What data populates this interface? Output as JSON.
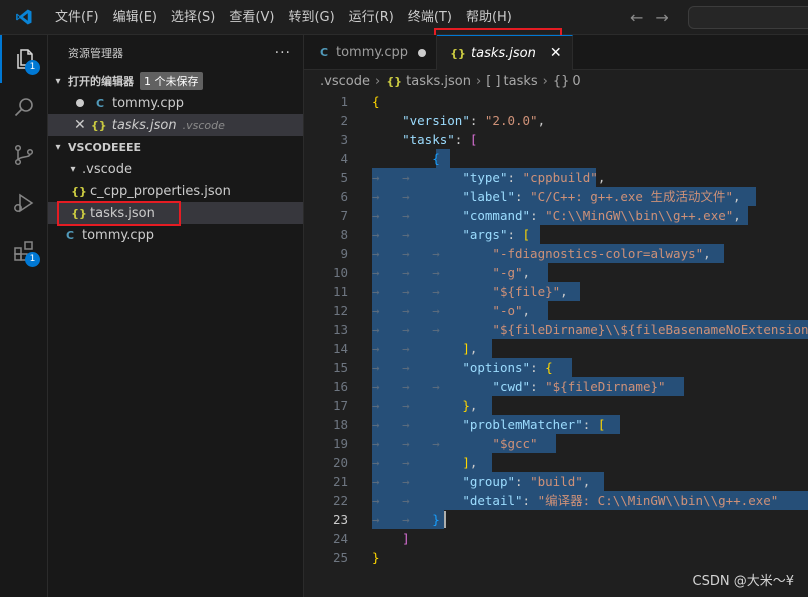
{
  "menu": [
    "文件(F)",
    "编辑(E)",
    "选择(S)",
    "查看(V)",
    "转到(G)",
    "运行(R)",
    "终端(T)",
    "帮助(H)"
  ],
  "activity": {
    "explorer_badge": "1",
    "extensions_badge": "1"
  },
  "sidebar": {
    "title": "资源管理器",
    "more": "···",
    "open_editors": {
      "label": "打开的编辑器",
      "unsaved": "1 个未保存",
      "items": [
        {
          "name": "tommy.cpp",
          "suffix": ""
        },
        {
          "name": "tasks.json",
          "suffix": ".vscode"
        }
      ]
    },
    "workspace": {
      "label": "VSCODEEEE",
      "folder": ".vscode",
      "files": [
        "c_cpp_properties.json",
        "tasks.json"
      ],
      "root_file": "tommy.cpp"
    }
  },
  "tabs": [
    {
      "label": "tommy.cpp",
      "icon": "C"
    },
    {
      "label": "tasks.json",
      "icon": "{}"
    }
  ],
  "breadcrumb": {
    "folder": ".vscode",
    "file": "tasks.json",
    "node1": "tasks",
    "node2": "0"
  },
  "watermark": "CSDN @大米～¥"
}
